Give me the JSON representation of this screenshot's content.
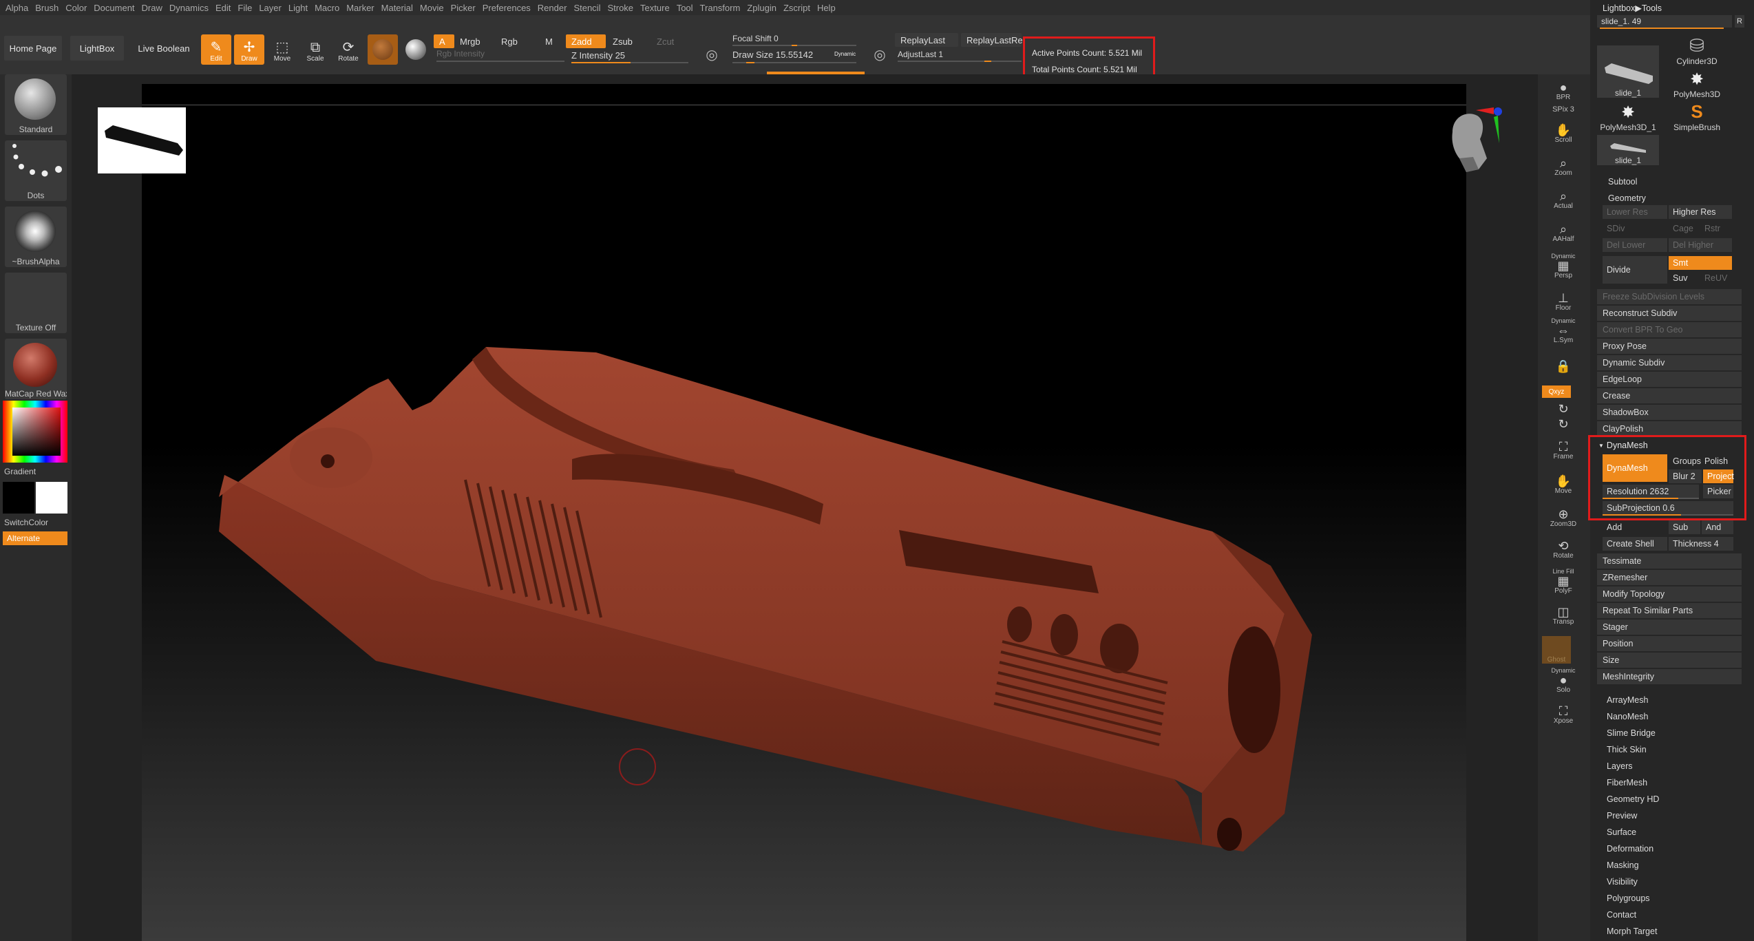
{
  "menu": [
    "Alpha",
    "Brush",
    "Color",
    "Document",
    "Draw",
    "Dynamics",
    "Edit",
    "File",
    "Layer",
    "Light",
    "Macro",
    "Marker",
    "Material",
    "Movie",
    "Picker",
    "Preferences",
    "Render",
    "Stencil",
    "Stroke",
    "Texture",
    "Tool",
    "Transform",
    "Zplugin",
    "Zscript",
    "Help"
  ],
  "shelf": {
    "home_page": "Home Page",
    "lightbox": "LightBox",
    "live_boolean": "Live Boolean",
    "edit": "Edit",
    "draw": "Draw",
    "move": "Move",
    "scale": "Scale",
    "rotate": "Rotate",
    "a_label": "A",
    "mrgb": "Mrgb",
    "rgb": "Rgb",
    "m": "M",
    "rgb_intensity": "Rgb Intensity",
    "zadd": "Zadd",
    "zsub": "Zsub",
    "zcut": "Zcut",
    "z_intensity": "Z Intensity 25",
    "focal_shift": "Focal Shift 0",
    "draw_size": "Draw Size 15.55142",
    "dynamic": "Dynamic",
    "replay_last": "ReplayLast",
    "replay_last_rel": "ReplayLastRel",
    "adjust_last": "AdjustLast 1",
    "active_points": "Active Points Count: 5.521 Mil",
    "total_points": "Total Points Count: 5.521 Mil"
  },
  "left_tray": {
    "standard": "Standard",
    "dots": "Dots",
    "brush_alpha": "~BrushAlpha",
    "texture_off": "Texture Off",
    "matcap": "MatCap Red Wax",
    "gradient": "Gradient",
    "switch_color": "SwitchColor",
    "alternate": "Alternate"
  },
  "right_shelf": {
    "bpr": "BPR",
    "spix": "SPix 3",
    "scroll": "Scroll",
    "zoom": "Zoom",
    "actual": "Actual",
    "aahalf": "AAHalf",
    "dynamic": "Dynamic",
    "persp": "Persp",
    "floor": "Floor",
    "lsym": "L.Sym",
    "xyz": "Qxyz",
    "frame": "Frame",
    "move": "Move",
    "zoom3d": "Zoom3D",
    "rotate": "Rotate",
    "line_fill": "Line Fill",
    "polyf": "PolyF",
    "transp": "Transp",
    "ghost": "Ghost",
    "solo": "Solo",
    "xpose": "Xpose"
  },
  "palette": {
    "header": "Lightbox▶Tools",
    "slider": "slide_1. 49",
    "r": "R",
    "tools": [
      "slide_1",
      "Cylinder3D",
      "PolyMesh3D",
      "PolyMesh3D_1",
      "SimpleBrush",
      "slide_1"
    ],
    "subtool": "Subtool",
    "geometry": "Geometry",
    "lower_res": "Lower Res",
    "higher_res": "Higher Res",
    "sdiv": "SDiv",
    "cage": "Cage",
    "rstr": "Rstr",
    "del_lower": "Del Lower",
    "del_higher": "Del Higher",
    "divide": "Divide",
    "smt": "Smt",
    "suv": "Suv",
    "reuv": "ReUV",
    "freeze": "Freeze SubDivision Levels",
    "reconstruct": "Reconstruct Subdiv",
    "convert_bpr": "Convert BPR To Geo",
    "proxy_pose": "Proxy Pose",
    "dynamic_subdiv": "Dynamic Subdiv",
    "edgeloop": "EdgeLoop",
    "crease": "Crease",
    "shadowbox": "ShadowBox",
    "claypolish": "ClayPolish",
    "dynamesh_header": "DynaMesh",
    "dynamesh_btn": "DynaMesh",
    "groups": "Groups",
    "polish": "Polish",
    "blur": "Blur 2",
    "project": "Project",
    "resolution": "Resolution 2632",
    "picker": "Picker",
    "subprojection": "SubProjection 0.6",
    "add": "Add",
    "sub": "Sub",
    "and": "And",
    "create_shell": "Create Shell",
    "thickness": "Thickness 4",
    "tessimate": "Tessimate",
    "zremesher": "ZRemesher",
    "modify_topology": "Modify Topology",
    "repeat_similar": "Repeat To Similar Parts",
    "stager": "Stager",
    "position": "Position",
    "size": "Size",
    "meshintegrity": "MeshIntegrity",
    "sections": [
      "ArrayMesh",
      "NanoMesh",
      "Slime Bridge",
      "Thick Skin",
      "Layers",
      "FiberMesh",
      "Geometry HD",
      "Preview",
      "Surface",
      "Deformation",
      "Masking",
      "Visibility",
      "Polygroups",
      "Contact",
      "Morph Target"
    ]
  },
  "colors": {
    "accent": "#ef8a1c",
    "highlight_box": "#e01b1b",
    "model": "#8e3a25"
  }
}
